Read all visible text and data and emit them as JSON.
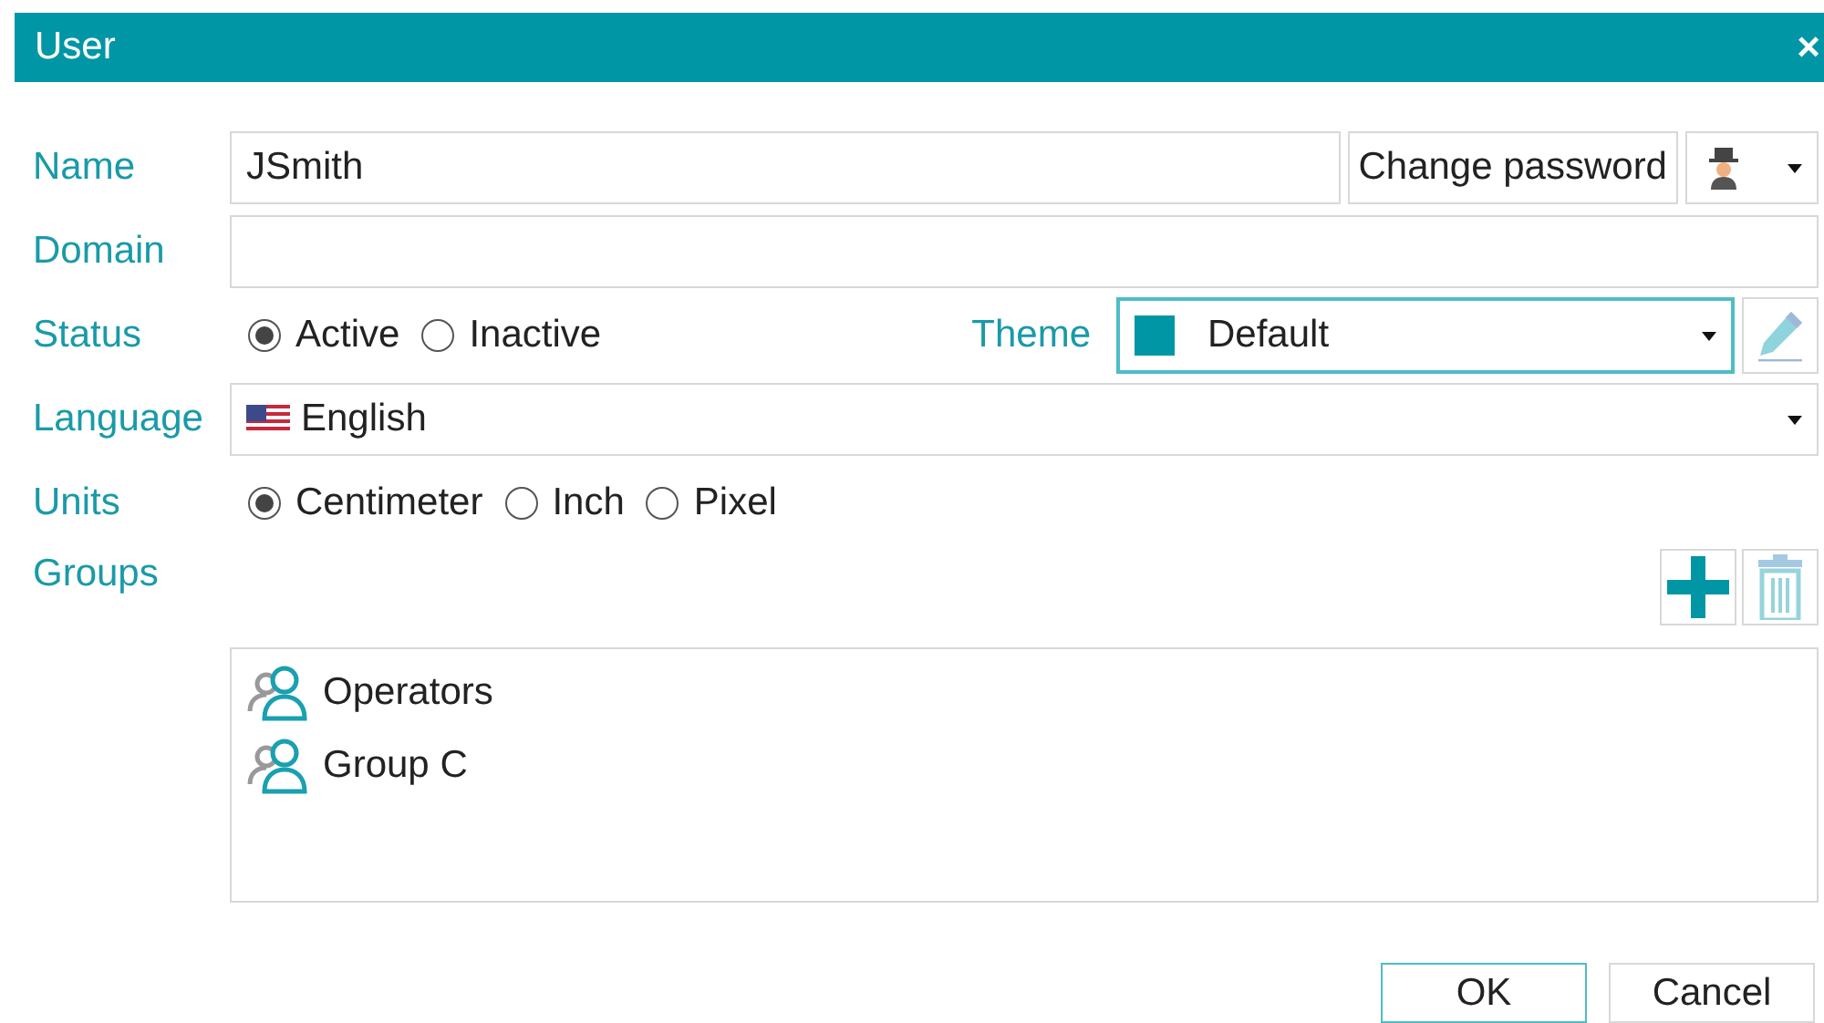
{
  "window": {
    "title": "User",
    "close": "×"
  },
  "name": {
    "label": "Name",
    "value": "JSmith",
    "change_password": "Change password"
  },
  "domain": {
    "label": "Domain"
  },
  "status": {
    "label": "Status",
    "options": [
      {
        "label": "Active",
        "selected": true
      },
      {
        "label": "Inactive",
        "selected": false
      }
    ]
  },
  "theme": {
    "label": "Theme",
    "value": "Default",
    "focused": true
  },
  "language": {
    "label": "Language",
    "value": "English"
  },
  "units": {
    "label": "Units",
    "options": [
      {
        "label": "Centimeter",
        "selected": true
      },
      {
        "label": "Inch",
        "selected": false
      },
      {
        "label": "Pixel",
        "selected": false
      }
    ]
  },
  "groups": {
    "label": "Groups",
    "tools": [
      {
        "kind": "add",
        "disabled": false
      },
      {
        "kind": "delete",
        "disabled": true
      }
    ],
    "items": [
      {
        "name": "Operators",
        "selected": false
      },
      {
        "name": "Group C",
        "selected": false
      }
    ]
  },
  "buttons": [
    {
      "label": "OK",
      "default": true
    },
    {
      "label": "Cancel",
      "default": false
    }
  ]
}
